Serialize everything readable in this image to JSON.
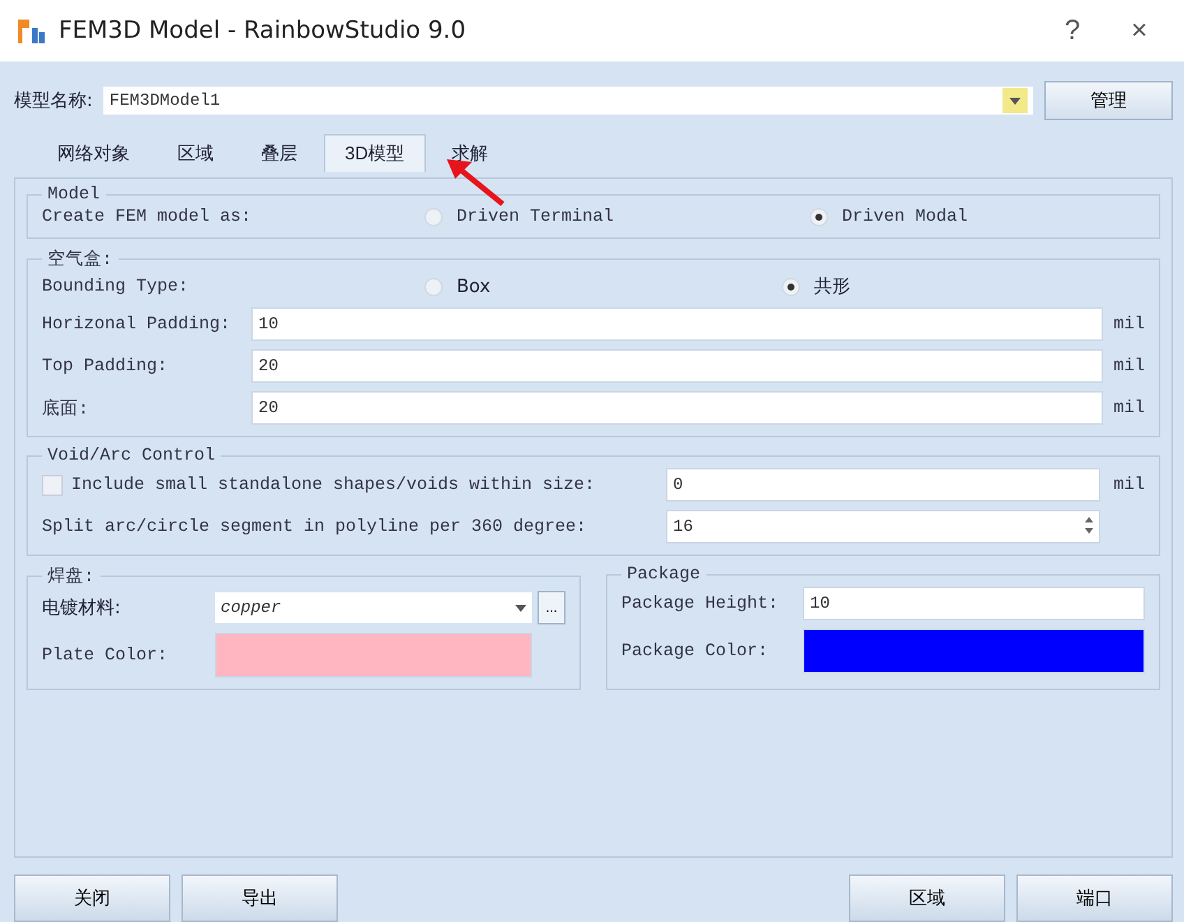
{
  "window": {
    "title": "FEM3D Model - RainbowStudio 9.0",
    "help": "?",
    "close": "×"
  },
  "model_name": {
    "label": "模型名称:",
    "value": "FEM3DModel1",
    "button": "管理"
  },
  "tabs": [
    {
      "label": "网络对象",
      "selected": false
    },
    {
      "label": "区域",
      "selected": false
    },
    {
      "label": "叠层",
      "selected": false
    },
    {
      "label": "3D模型",
      "selected": true
    },
    {
      "label": "求解",
      "selected": false
    }
  ],
  "model_group": {
    "title": "Model",
    "label": "Create FEM model as:",
    "options": [
      {
        "label": "Driven Terminal",
        "selected": false
      },
      {
        "label": "Driven Modal",
        "selected": true
      }
    ]
  },
  "air_box": {
    "title": "空气盒:",
    "bounding": {
      "label": "Bounding Type:",
      "options": [
        {
          "label": "Box",
          "selected": false
        },
        {
          "label": "共形",
          "selected": true
        }
      ]
    },
    "fields": [
      {
        "label": "Horizonal Padding:",
        "value": "10",
        "unit": "mil"
      },
      {
        "label": "Top Padding:",
        "value": "20",
        "unit": "mil"
      },
      {
        "label": "底面:",
        "value": "20",
        "unit": "mil"
      }
    ]
  },
  "void_arc": {
    "title": "Void/Arc Control",
    "include": {
      "label": "Include small standalone shapes/voids within size:",
      "checked": false,
      "value": "0",
      "unit": "mil"
    },
    "split": {
      "label": "Split arc/circle segment in polyline per 360 degree:",
      "value": "16"
    }
  },
  "pad": {
    "title": "焊盘:",
    "material": {
      "label": "电镀材料:",
      "value": "copper",
      "browse": "..."
    },
    "plate_color": {
      "label": "Plate Color:",
      "color": "#ffb6c1"
    }
  },
  "package": {
    "title": "Package",
    "height": {
      "label": "Package Height:",
      "value": "10"
    },
    "color": {
      "label": "Package Color:",
      "color": "#0000ff"
    }
  },
  "footer": {
    "left_buttons": [
      "关闭",
      "导出"
    ],
    "right_buttons": [
      "区域",
      "端口"
    ]
  }
}
